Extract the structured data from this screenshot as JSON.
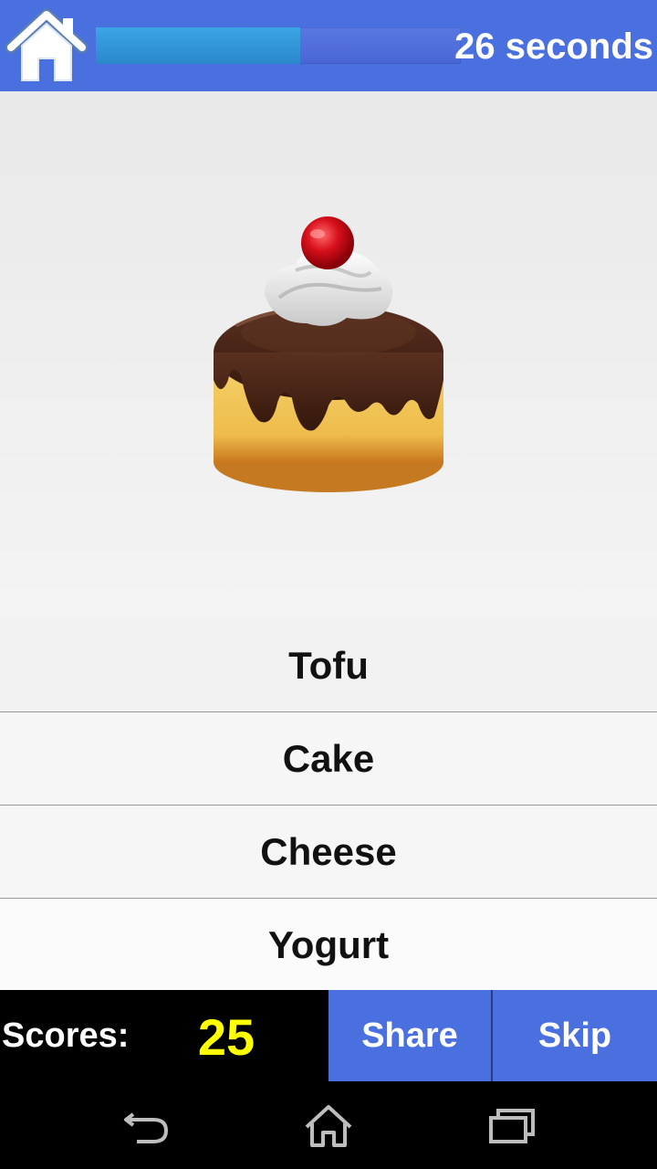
{
  "header": {
    "home_icon": "home-icon",
    "timer_text": "26 seconds",
    "timer_progress": 0.56,
    "timer_fill_color": "#2f94d6",
    "bar_color": "#4a6fde"
  },
  "question": {
    "image_icon": "cake-image"
  },
  "answers": [
    {
      "label": "Tofu"
    },
    {
      "label": "Cake"
    },
    {
      "label": "Cheese"
    },
    {
      "label": "Yogurt"
    }
  ],
  "footer": {
    "scores_label": "Scores:",
    "scores_value": "25",
    "scores_color": "#ffff00",
    "share_label": "Share",
    "skip_label": "Skip"
  },
  "system_nav": {
    "back_icon": "back-icon",
    "home_icon": "home-outline-icon",
    "recents_icon": "recents-icon"
  }
}
